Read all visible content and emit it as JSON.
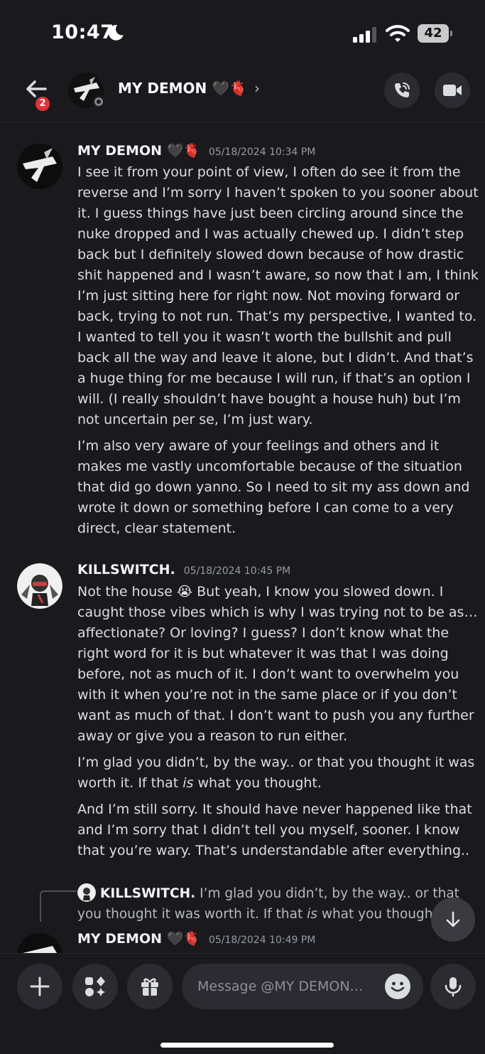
{
  "status_bar": {
    "time": "10:47",
    "battery": "42"
  },
  "header": {
    "back_badge": "2",
    "title": "MY DEMON 🖤🫀",
    "chevron": "›"
  },
  "messages": [
    {
      "author": "MY DEMON 🖤🫀",
      "timestamp": "05/18/2024 10:34 PM",
      "paragraphs": [
        "I see it from your point of view, I often do see it from the reverse and I’m sorry I haven’t spoken to you sooner about it. I guess things have just been circling around since the nuke dropped and I was actually chewed up. I didn’t step back but I definitely slowed down because of how drastic shit happened and I wasn’t aware, so now that I am, I think I’m just sitting here for right now. Not moving forward or back, trying to not run. That’s my perspective, I wanted to. I wanted to tell you it wasn’t worth the bullshit and pull back all the way and leave it alone, but I didn’t. And that’s a huge thing for me because I will run, if that’s an option I will. (I really shouldn’t have bought a house huh) but I’m not uncertain per se, I’m just wary.",
        "I’m also very aware of your feelings and others and it makes me vastly uncomfortable because of the situation that did go down yanno. So I need to sit my ass down and wrote it down or something before I can come to a very direct, clear statement."
      ]
    },
    {
      "author": "KILLSWITCH.",
      "timestamp": "05/18/2024 10:45 PM",
      "paragraphs": [
        "Not the house 😭 But yeah, I know you slowed down. I caught those vibes which is why I was trying not to be as… affectionate? Or loving? I guess? I don’t know what the right word for it is but whatever it was that I was doing before, not as much of it. I don’t want to overwhelm you with it when you’re not in the same place or if you don’t want as much of that. I don’t want to push you any further away or give you a reason to run either.",
        "I’m glad you didn’t, by the way.. or that you thought it was worth it. If that",
        "is",
        "what you thought.",
        "And I’m still sorry. It should have never happened like that and I’m sorry that I didn’t tell you myself, sooner. I know that you’re wary. That’s understandable after everything.."
      ]
    },
    {
      "author": "MY DEMON 🖤🫀",
      "timestamp": "05/18/2024 10:49 PM"
    }
  ],
  "reply_preview": {
    "author": "KILLSWITCH.",
    "text_before": "I’m glad you didn’t, by the way.. or that you thought it was worth it. If that",
    "text_em": "is",
    "text_after": "what you thought."
  },
  "composer": {
    "placeholder": "Message @MY DEMON…"
  },
  "colors": {
    "background": "#1a1a1e",
    "button": "#2b2b31",
    "badge": "#e2323a"
  },
  "icons": [
    "back-arrow-icon",
    "moon-icon",
    "signal-icon",
    "wifi-icon",
    "phone-call-icon",
    "video-camera-icon",
    "plus-icon",
    "apps-icon",
    "gift-icon",
    "emoji-icon",
    "microphone-icon",
    "arrow-down-icon"
  ]
}
